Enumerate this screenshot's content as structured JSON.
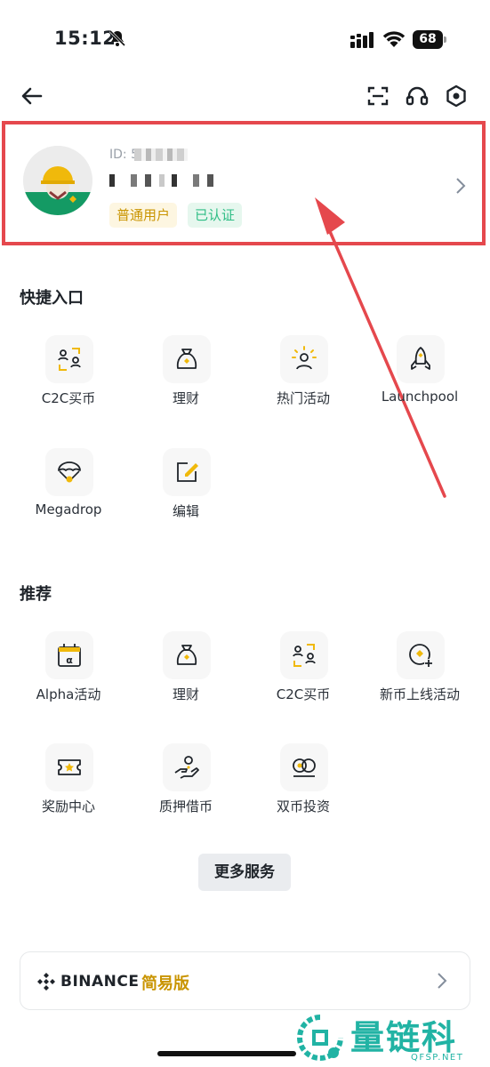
{
  "status_bar": {
    "time": "15:12",
    "battery": "68"
  },
  "profile": {
    "id_label": "ID: 5 ",
    "badge_normal": "普通用户",
    "badge_verified": "已认证"
  },
  "quick_access": {
    "title": "快捷入口",
    "items": [
      {
        "label": "C2C买币",
        "icon": "c2c-icon"
      },
      {
        "label": "理财",
        "icon": "moneybag-icon"
      },
      {
        "label": "热门活动",
        "icon": "activity-icon"
      },
      {
        "label": "Launchpool",
        "icon": "rocket-icon"
      },
      {
        "label": "Megadrop",
        "icon": "parachute-icon"
      },
      {
        "label": "编辑",
        "icon": "edit-icon"
      }
    ]
  },
  "recommend": {
    "title": "推荐",
    "items": [
      {
        "label": "Alpha活动",
        "icon": "calendar-alpha-icon"
      },
      {
        "label": "理财",
        "icon": "moneybag-icon"
      },
      {
        "label": "C2C买币",
        "icon": "c2c-icon"
      },
      {
        "label": "新币上线活动",
        "icon": "new-listing-icon"
      },
      {
        "label": "奖励中心",
        "icon": "ticket-icon"
      },
      {
        "label": "质押借币",
        "icon": "loan-icon"
      },
      {
        "label": "双币投资",
        "icon": "dual-coin-icon"
      }
    ]
  },
  "more_services": "更多服务",
  "lite_mode": {
    "brand": "BINANCE",
    "label": "简易版"
  },
  "watermark": {
    "text": "量链科技",
    "sub": "QFSP.NET"
  },
  "colors": {
    "accent": "#F0B90B",
    "annotation": "#E5484D",
    "verified": "#2EBD85"
  }
}
